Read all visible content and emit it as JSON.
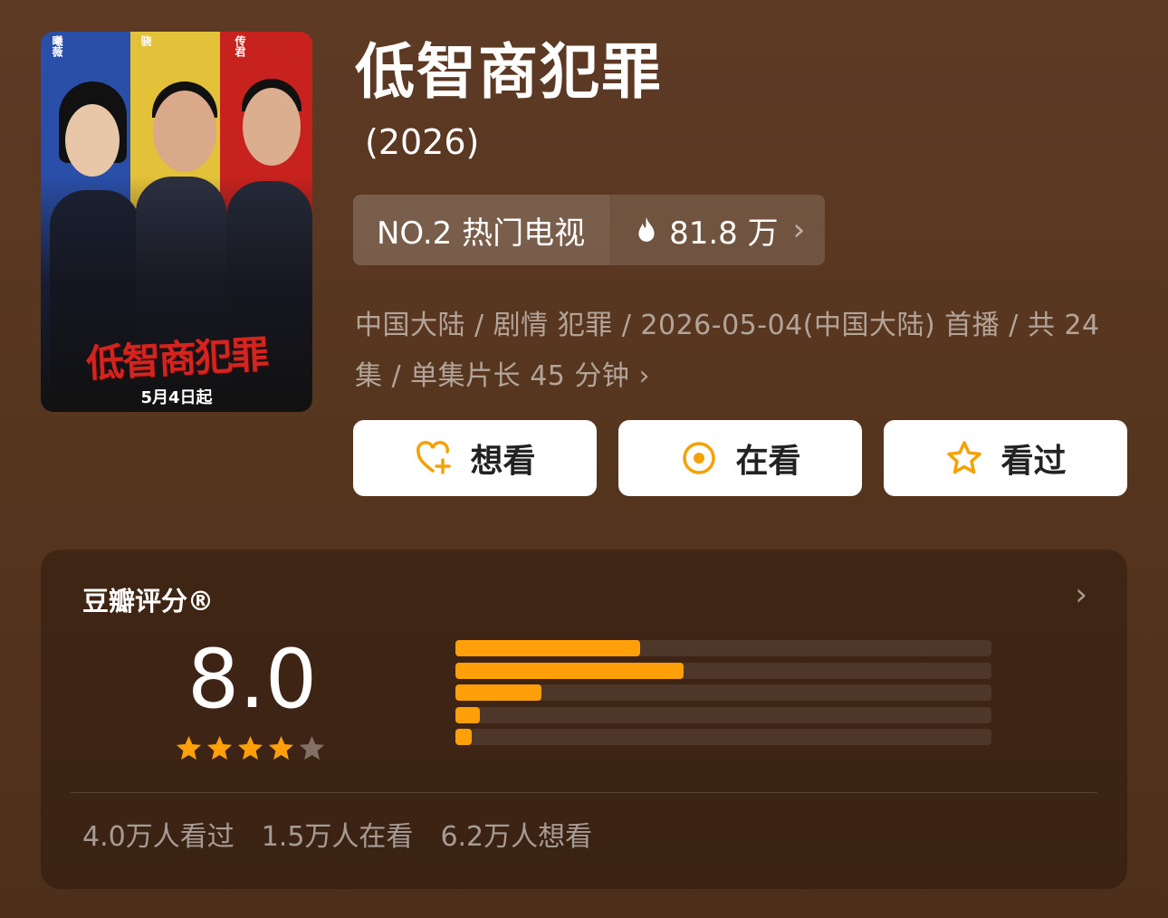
{
  "poster": {
    "title_art": "低智商犯罪",
    "date_text": "5月4日起",
    "cast": [
      "曦薇",
      "骁",
      "传君"
    ]
  },
  "show": {
    "title": "低智商犯罪",
    "year": "(2026)"
  },
  "rank": {
    "label": "NO.2 热门电视",
    "heat": "81.8 万",
    "flame_icon": "flame-icon",
    "chevron": "›"
  },
  "meta": {
    "line": "中国大陆 / 剧情 犯罪 / 2026-05-04(中国大陆) 首播 / 共 24 集 / 单集片长 45 分钟",
    "chevron": "›"
  },
  "actions": [
    {
      "label": "想看",
      "icon": "heart-plus-icon"
    },
    {
      "label": "在看",
      "icon": "target-icon"
    },
    {
      "label": "看过",
      "icon": "star-outline-icon"
    }
  ],
  "rating": {
    "title": "豆瓣评分®",
    "score": "8.0",
    "stars": 4,
    "distribution": [
      {
        "stars": 5,
        "percent": 34.5
      },
      {
        "stars": 4,
        "percent": 42.5
      },
      {
        "stars": 3,
        "percent": 16
      },
      {
        "stars": 2,
        "percent": 4.5
      },
      {
        "stars": 1,
        "percent": 3
      }
    ],
    "counts": [
      "4.0万人看过",
      "1.5万人在看",
      "6.2万人想看"
    ]
  },
  "colors": {
    "accent": "#ff9f0a",
    "background": "#57361f"
  }
}
